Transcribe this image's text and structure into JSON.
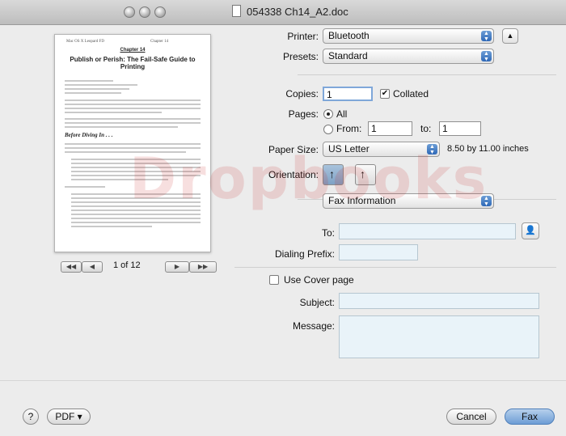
{
  "window": {
    "title": "054338 Ch14_A2.doc"
  },
  "preview": {
    "header_left": "Mac OS X Leopard FD",
    "header_right": "Chapter 14",
    "chapter": "Chapter 14",
    "title": "Publish or Perish: The Fail-Safe Guide to Printing",
    "section": "Before Diving In . . ."
  },
  "pager": {
    "first": "◀◀",
    "prev": "◀",
    "count": "1 of 12",
    "next": "▶",
    "last": "▶▶"
  },
  "printer": {
    "label": "Printer:",
    "value": "Bluetooth"
  },
  "presets": {
    "label": "Presets:",
    "value": "Standard"
  },
  "copies": {
    "label": "Copies:",
    "value": "1",
    "collated_label": "Collated",
    "collated": true
  },
  "pages": {
    "label": "Pages:",
    "all_label": "All",
    "from_label": "From:",
    "from_value": "1",
    "to_label": "to:",
    "to_value": "1"
  },
  "paper": {
    "label": "Paper Size:",
    "value": "US Letter",
    "dims": "8.50 by 11.00 inches"
  },
  "orientation": {
    "label": "Orientation:"
  },
  "section_popup": {
    "value": "Fax Information"
  },
  "fax": {
    "to_label": "To:",
    "to_value": "",
    "dialing_label": "Dialing Prefix:",
    "dialing_value": "",
    "cover_label": "Use Cover page",
    "subject_label": "Subject:",
    "subject_value": "",
    "message_label": "Message:",
    "message_value": ""
  },
  "footer": {
    "help": "?",
    "pdf": "PDF ▾",
    "cancel": "Cancel",
    "fax": "Fax"
  },
  "watermark": "Dropbooks",
  "colors": {
    "accent": "#3a72c0",
    "field_blue": "#e9f3f9"
  }
}
